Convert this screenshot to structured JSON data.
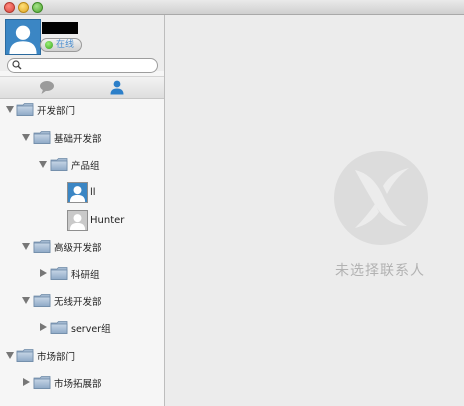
{
  "profile": {
    "status_label": "在线"
  },
  "search": {
    "placeholder": ""
  },
  "tree": {
    "dept_dev": "开发部门",
    "group_base": "基础开发部",
    "group_product": "产品组",
    "contact_1": "ll",
    "contact_2": "Hunter",
    "group_senior": "高级开发部",
    "group_research": "科研组",
    "group_wireless": "无线开发部",
    "group_server": "server组",
    "dept_market": "市场部门",
    "group_market_expand": "市场拓展部"
  },
  "main": {
    "empty_text": "未选择联系人"
  },
  "colors": {
    "accent": "#3b86c4",
    "status_online": "#36a21a",
    "muted_text": "#b2b2b2"
  }
}
